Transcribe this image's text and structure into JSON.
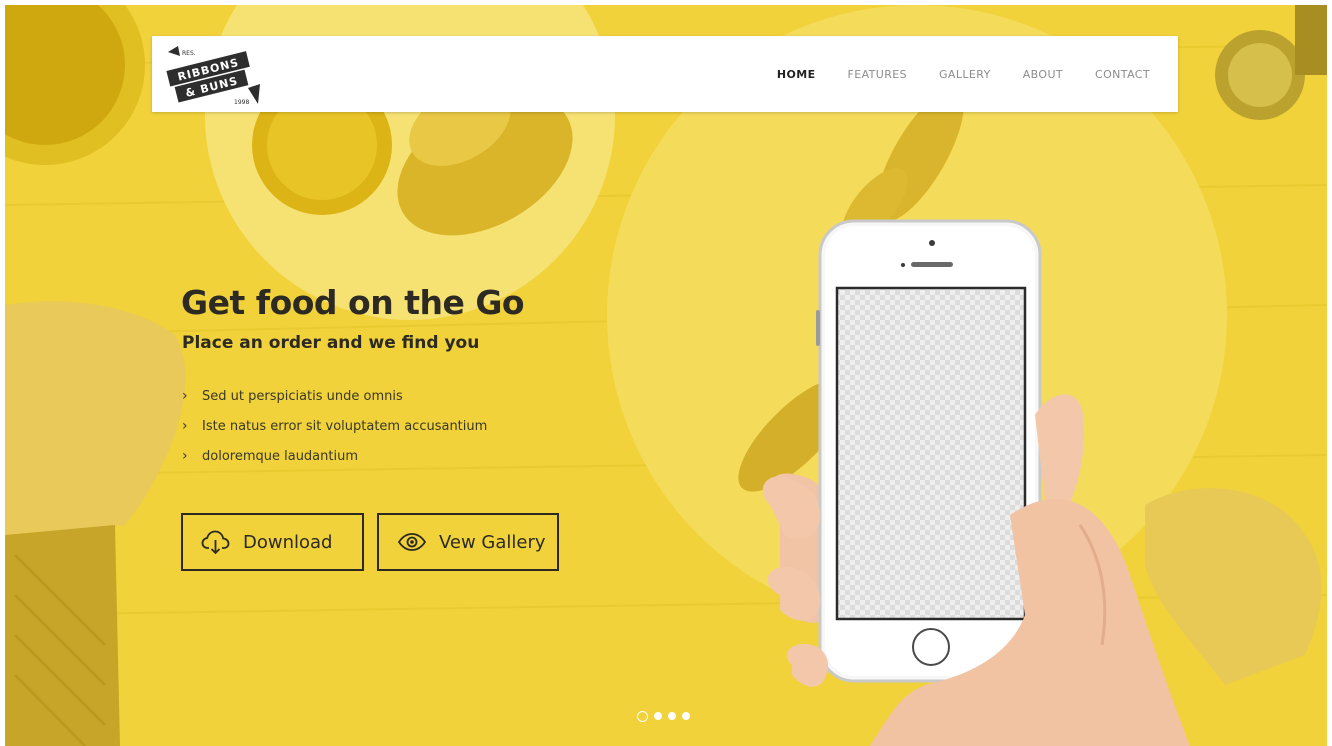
{
  "theme": {
    "accent": "#f1d23a",
    "text": "#2c2a22",
    "nav_active": "#222222",
    "nav_inactive": "#8c8c8c"
  },
  "brand": {
    "top": "RES.",
    "line1": "RIBBONS",
    "line2": "& BUNS",
    "year": "1998"
  },
  "nav": {
    "items": [
      {
        "label": "HOME",
        "active": true
      },
      {
        "label": "FEATURES",
        "active": false
      },
      {
        "label": "GALLERY",
        "active": false
      },
      {
        "label": "ABOUT",
        "active": false
      },
      {
        "label": "CONTACT",
        "active": false
      }
    ]
  },
  "hero": {
    "title_prefix": "Get food on the ",
    "title_bold": "Go",
    "subtitle": "Place an order and we find you",
    "features": [
      "Sed ut perspiciatis unde omnis",
      "Iste natus error sit voluptatem accusantium",
      "doloremque laudantium"
    ],
    "download_label": "Download",
    "gallery_label": "Vew Gallery",
    "download_icon": "cloud-download-icon",
    "gallery_icon": "eye-icon"
  },
  "slider": {
    "count": 4,
    "active_index": 0
  }
}
